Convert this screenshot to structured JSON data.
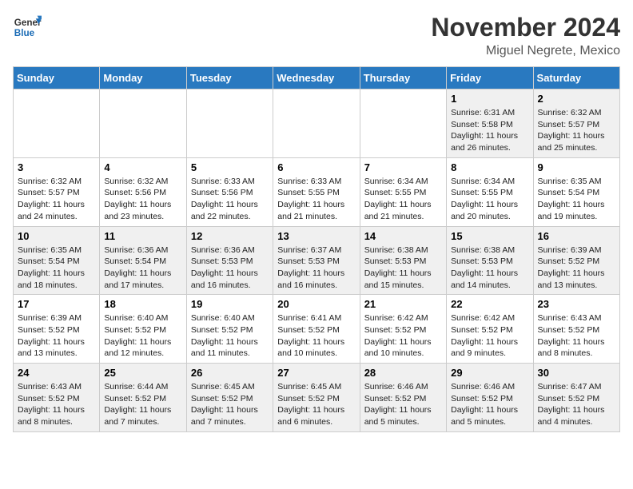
{
  "logo": {
    "general": "General",
    "blue": "Blue"
  },
  "header": {
    "month": "November 2024",
    "location": "Miguel Negrete, Mexico"
  },
  "weekdays": [
    "Sunday",
    "Monday",
    "Tuesday",
    "Wednesday",
    "Thursday",
    "Friday",
    "Saturday"
  ],
  "weeks": [
    [
      {
        "day": "",
        "info": ""
      },
      {
        "day": "",
        "info": ""
      },
      {
        "day": "",
        "info": ""
      },
      {
        "day": "",
        "info": ""
      },
      {
        "day": "",
        "info": ""
      },
      {
        "day": "1",
        "info": "Sunrise: 6:31 AM\nSunset: 5:58 PM\nDaylight: 11 hours\nand 26 minutes."
      },
      {
        "day": "2",
        "info": "Sunrise: 6:32 AM\nSunset: 5:57 PM\nDaylight: 11 hours\nand 25 minutes."
      }
    ],
    [
      {
        "day": "3",
        "info": "Sunrise: 6:32 AM\nSunset: 5:57 PM\nDaylight: 11 hours\nand 24 minutes."
      },
      {
        "day": "4",
        "info": "Sunrise: 6:32 AM\nSunset: 5:56 PM\nDaylight: 11 hours\nand 23 minutes."
      },
      {
        "day": "5",
        "info": "Sunrise: 6:33 AM\nSunset: 5:56 PM\nDaylight: 11 hours\nand 22 minutes."
      },
      {
        "day": "6",
        "info": "Sunrise: 6:33 AM\nSunset: 5:55 PM\nDaylight: 11 hours\nand 21 minutes."
      },
      {
        "day": "7",
        "info": "Sunrise: 6:34 AM\nSunset: 5:55 PM\nDaylight: 11 hours\nand 21 minutes."
      },
      {
        "day": "8",
        "info": "Sunrise: 6:34 AM\nSunset: 5:55 PM\nDaylight: 11 hours\nand 20 minutes."
      },
      {
        "day": "9",
        "info": "Sunrise: 6:35 AM\nSunset: 5:54 PM\nDaylight: 11 hours\nand 19 minutes."
      }
    ],
    [
      {
        "day": "10",
        "info": "Sunrise: 6:35 AM\nSunset: 5:54 PM\nDaylight: 11 hours\nand 18 minutes."
      },
      {
        "day": "11",
        "info": "Sunrise: 6:36 AM\nSunset: 5:54 PM\nDaylight: 11 hours\nand 17 minutes."
      },
      {
        "day": "12",
        "info": "Sunrise: 6:36 AM\nSunset: 5:53 PM\nDaylight: 11 hours\nand 16 minutes."
      },
      {
        "day": "13",
        "info": "Sunrise: 6:37 AM\nSunset: 5:53 PM\nDaylight: 11 hours\nand 16 minutes."
      },
      {
        "day": "14",
        "info": "Sunrise: 6:38 AM\nSunset: 5:53 PM\nDaylight: 11 hours\nand 15 minutes."
      },
      {
        "day": "15",
        "info": "Sunrise: 6:38 AM\nSunset: 5:53 PM\nDaylight: 11 hours\nand 14 minutes."
      },
      {
        "day": "16",
        "info": "Sunrise: 6:39 AM\nSunset: 5:52 PM\nDaylight: 11 hours\nand 13 minutes."
      }
    ],
    [
      {
        "day": "17",
        "info": "Sunrise: 6:39 AM\nSunset: 5:52 PM\nDaylight: 11 hours\nand 13 minutes."
      },
      {
        "day": "18",
        "info": "Sunrise: 6:40 AM\nSunset: 5:52 PM\nDaylight: 11 hours\nand 12 minutes."
      },
      {
        "day": "19",
        "info": "Sunrise: 6:40 AM\nSunset: 5:52 PM\nDaylight: 11 hours\nand 11 minutes."
      },
      {
        "day": "20",
        "info": "Sunrise: 6:41 AM\nSunset: 5:52 PM\nDaylight: 11 hours\nand 10 minutes."
      },
      {
        "day": "21",
        "info": "Sunrise: 6:42 AM\nSunset: 5:52 PM\nDaylight: 11 hours\nand 10 minutes."
      },
      {
        "day": "22",
        "info": "Sunrise: 6:42 AM\nSunset: 5:52 PM\nDaylight: 11 hours\nand 9 minutes."
      },
      {
        "day": "23",
        "info": "Sunrise: 6:43 AM\nSunset: 5:52 PM\nDaylight: 11 hours\nand 8 minutes."
      }
    ],
    [
      {
        "day": "24",
        "info": "Sunrise: 6:43 AM\nSunset: 5:52 PM\nDaylight: 11 hours\nand 8 minutes."
      },
      {
        "day": "25",
        "info": "Sunrise: 6:44 AM\nSunset: 5:52 PM\nDaylight: 11 hours\nand 7 minutes."
      },
      {
        "day": "26",
        "info": "Sunrise: 6:45 AM\nSunset: 5:52 PM\nDaylight: 11 hours\nand 7 minutes."
      },
      {
        "day": "27",
        "info": "Sunrise: 6:45 AM\nSunset: 5:52 PM\nDaylight: 11 hours\nand 6 minutes."
      },
      {
        "day": "28",
        "info": "Sunrise: 6:46 AM\nSunset: 5:52 PM\nDaylight: 11 hours\nand 5 minutes."
      },
      {
        "day": "29",
        "info": "Sunrise: 6:46 AM\nSunset: 5:52 PM\nDaylight: 11 hours\nand 5 minutes."
      },
      {
        "day": "30",
        "info": "Sunrise: 6:47 AM\nSunset: 5:52 PM\nDaylight: 11 hours\nand 4 minutes."
      }
    ]
  ]
}
